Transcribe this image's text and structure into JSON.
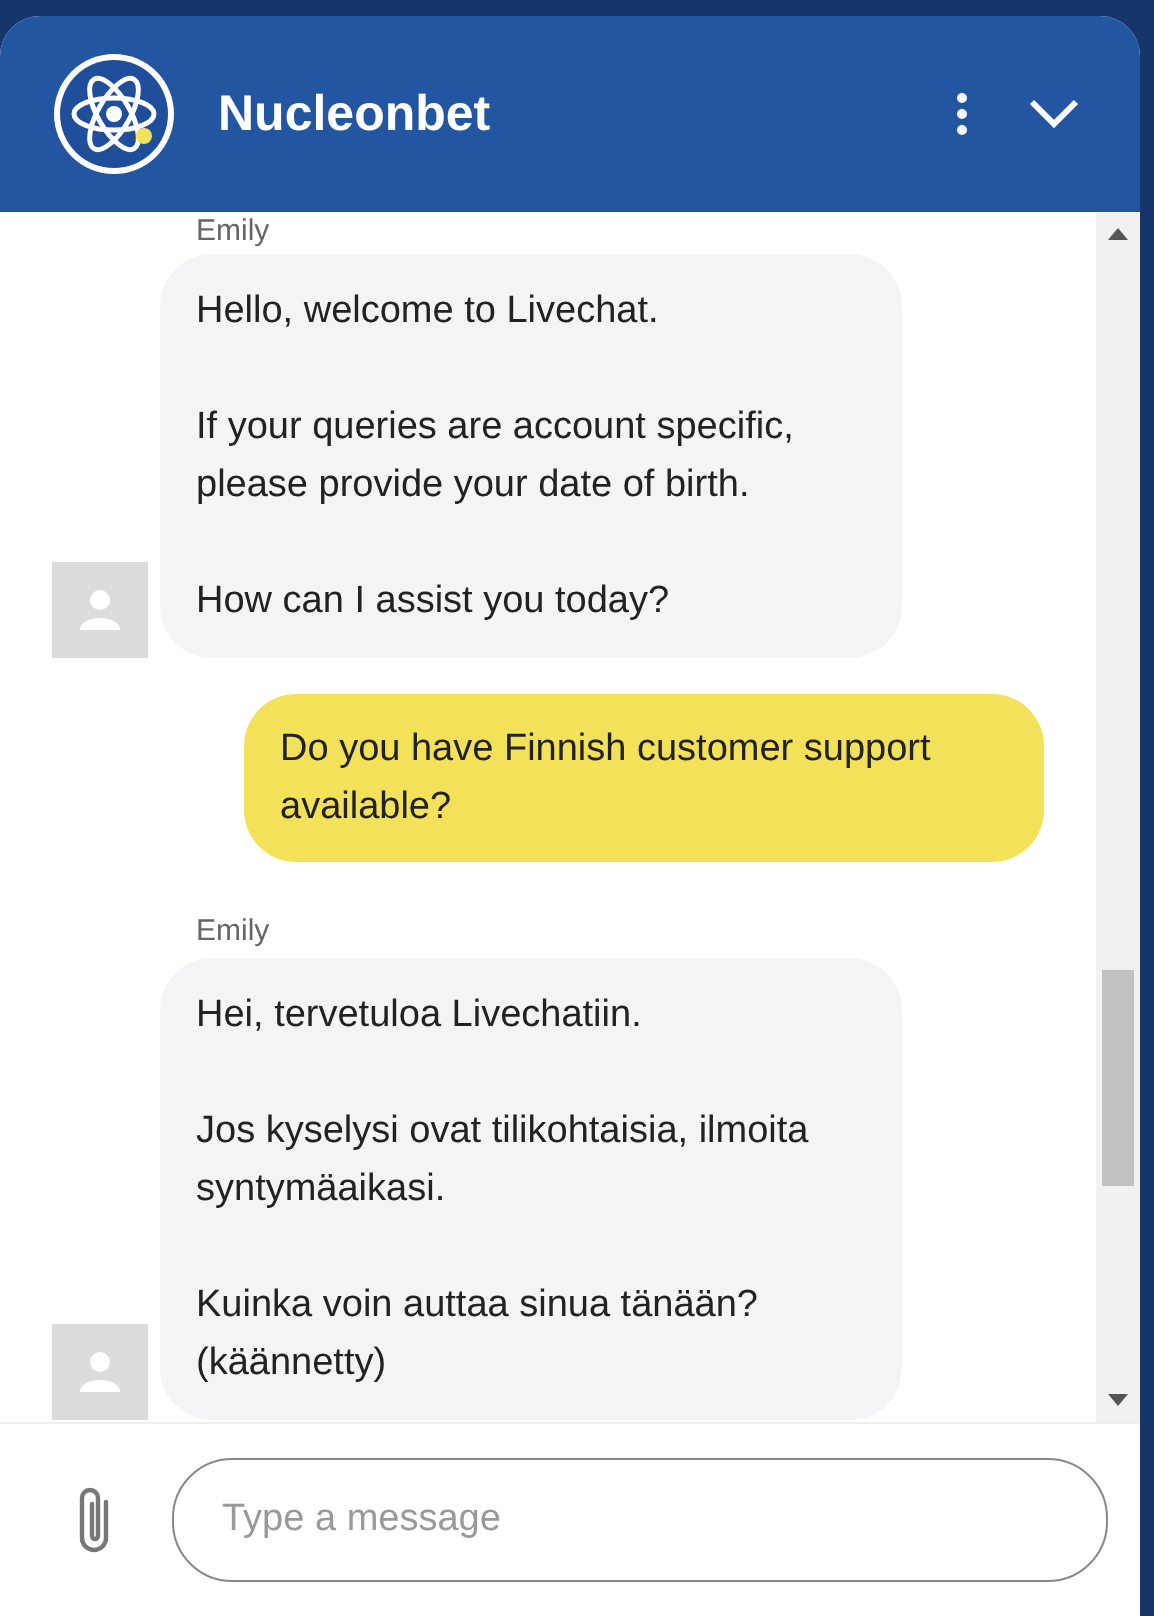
{
  "header": {
    "title": "Nucleonbet"
  },
  "messages": [
    {
      "kind": "agent",
      "sender": "Emily",
      "paragraphs": [
        "Hello, welcome to Livechat.",
        "If your queries are account specific, please provide your date of birth.",
        "How can I assist you today?"
      ]
    },
    {
      "kind": "user",
      "paragraphs": [
        "Do you have Finnish customer support available?"
      ]
    },
    {
      "kind": "agent",
      "sender": "Emily",
      "paragraphs": [
        "Hei, tervetuloa Livechatiin.",
        "Jos kyselysi ovat tilikohtaisia, ilmoita syntymäaikasi.",
        "Kuinka voin auttaa sinua tänään? (käännetty)"
      ]
    }
  ],
  "composer": {
    "placeholder": "Type a message"
  }
}
